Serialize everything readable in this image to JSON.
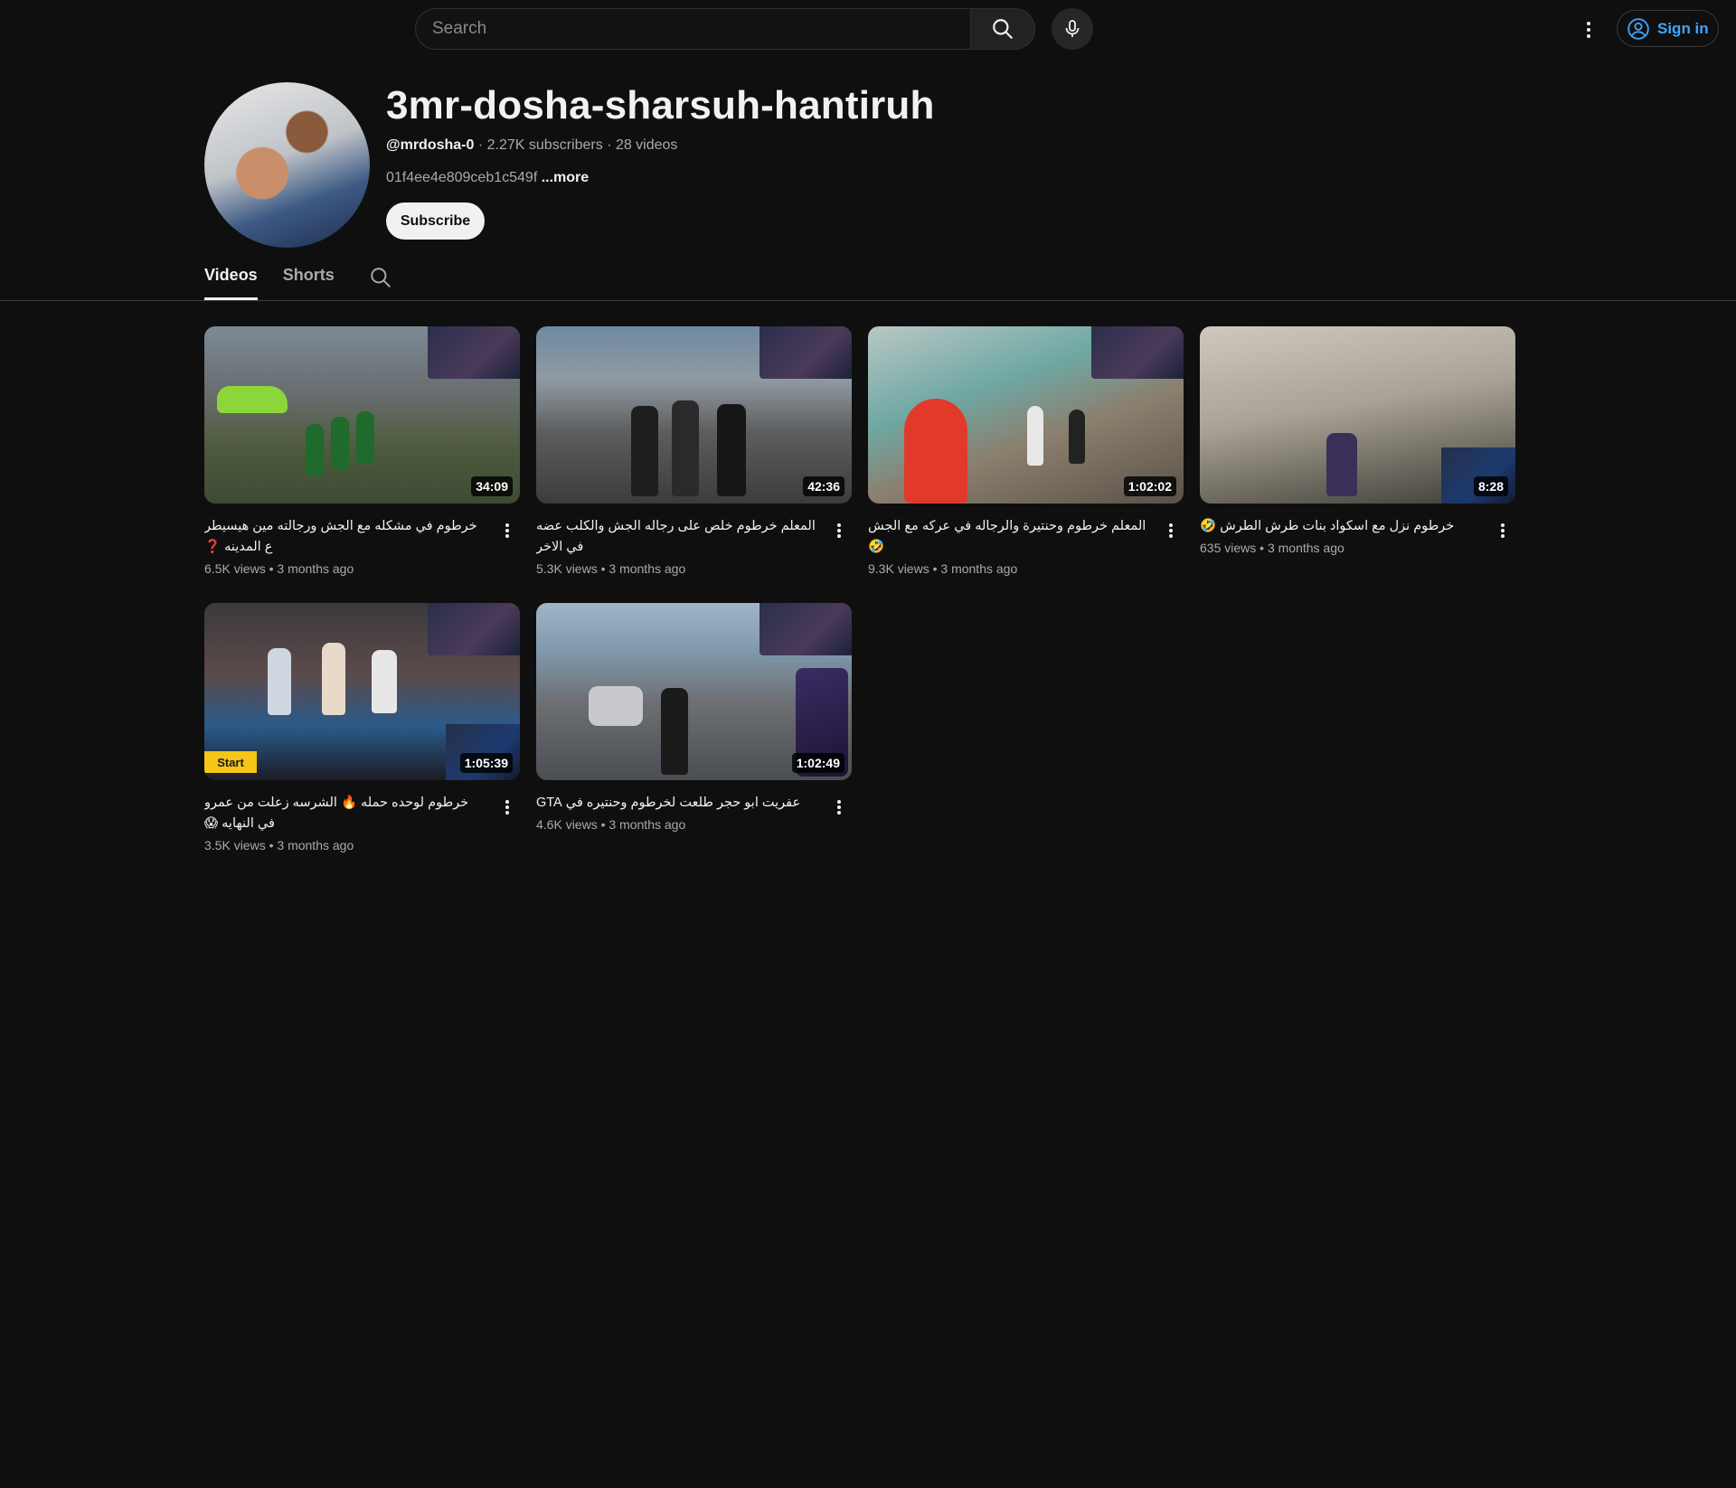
{
  "topbar": {
    "search_placeholder": "Search",
    "sign_in_label": "Sign in"
  },
  "channel": {
    "title": "3mr-dosha-sharsuh-hantiruh",
    "handle": "@mrdosha-0",
    "subscribers": "2.27K subscribers",
    "video_count": "28 videos",
    "description": "01f4ee4e809ceb1c549f",
    "more_label": "...more",
    "subscribe_label": "Subscribe"
  },
  "tabs": [
    {
      "label": "Videos",
      "active": true
    },
    {
      "label": "Shorts",
      "active": false
    }
  ],
  "videos": [
    {
      "title": "خرطوم في مشكله مع الجش ورجالته مين هيسيطر ع المدينه ❓",
      "duration": "34:09",
      "views": "6.5K views",
      "age": "3 months ago"
    },
    {
      "title": "المعلم خرطوم خلص على رجاله الجش والكلب عضه في الاخر",
      "duration": "42:36",
      "views": "5.3K views",
      "age": "3 months ago"
    },
    {
      "title": "المعلم خرطوم وحنتيرة والرجاله في عركه مع الجش 🤣",
      "duration": "1:02:02",
      "views": "9.3K views",
      "age": "3 months ago"
    },
    {
      "title": "خرطوم نزل مع اسكواد بنات طرش الطرش 🤣",
      "duration": "8:28",
      "views": "635 views",
      "age": "3 months ago"
    },
    {
      "title": "خرطوم لوحده حمله 🔥 الشرسه زعلت من عمرو في النهايه 😱",
      "duration": "1:05:39",
      "views": "3.5K views",
      "age": "3 months ago",
      "badge": "Start"
    },
    {
      "title": "عفريت ابو حجر طلعت لخرطوم وحنتيره في GTA",
      "duration": "1:02:49",
      "views": "4.6K views",
      "age": "3 months ago"
    }
  ],
  "icons": {
    "search": "search-icon",
    "mic": "microphone-icon",
    "menu": "vertical-dots-icon",
    "account": "account-circle-icon"
  },
  "colors": {
    "background": "#0f0f0f",
    "accent_link": "#3ea6ff",
    "text_primary": "#f1f1f1",
    "text_secondary": "#aaaaaa"
  }
}
